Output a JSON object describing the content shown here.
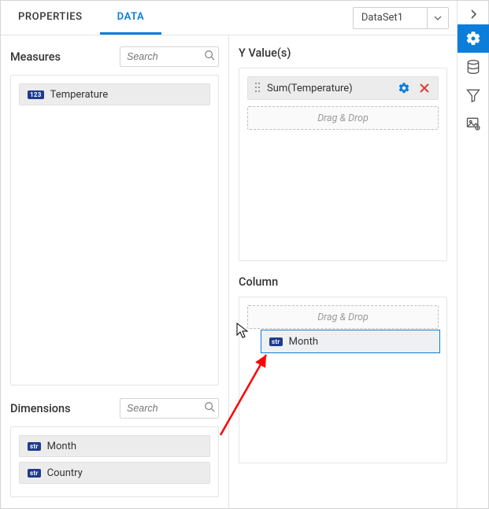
{
  "tabs": {
    "properties": "PROPERTIES",
    "data": "DATA",
    "active": "data"
  },
  "dataset": {
    "selected": "DataSet1"
  },
  "measures": {
    "title": "Measures",
    "search_placeholder": "Search",
    "items": [
      {
        "label": "Temperature",
        "badge": "123",
        "type": "num"
      }
    ]
  },
  "dimensions": {
    "title": "Dimensions",
    "search_placeholder": "Search",
    "items": [
      {
        "label": "Month",
        "badge": "str",
        "type": "str"
      },
      {
        "label": "Country",
        "badge": "str",
        "type": "str"
      }
    ]
  },
  "yvalues": {
    "title": "Y Value(s)",
    "items": [
      {
        "label": "Sum(Temperature)"
      }
    ],
    "dropzone": "Drag & Drop"
  },
  "column": {
    "title": "Column",
    "dropzone": "Drag & Drop"
  },
  "dragging": {
    "label": "Month",
    "badge": "str"
  },
  "sidebar": {
    "items": [
      "expand",
      "settings",
      "data",
      "filter",
      "image"
    ]
  }
}
